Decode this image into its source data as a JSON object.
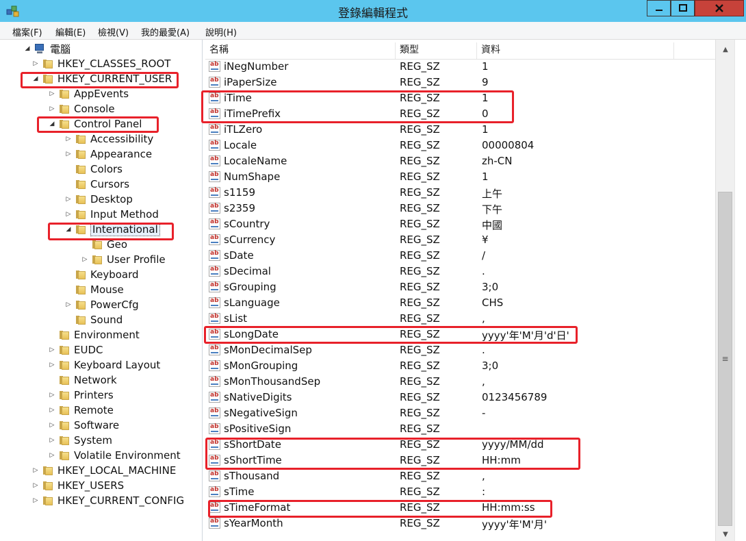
{
  "window": {
    "title": "登錄編輯程式"
  },
  "menu": [
    "檔案(F)",
    "編輯(E)",
    "檢視(V)",
    "我的最愛(A)",
    "說明(H)"
  ],
  "tree": [
    {
      "label": "電腦",
      "depth": 0,
      "exp": "open",
      "icon": "computer"
    },
    {
      "label": "HKEY_CLASSES_ROOT",
      "depth": 1,
      "exp": "closed"
    },
    {
      "label": "HKEY_CURRENT_USER",
      "depth": 1,
      "exp": "open"
    },
    {
      "label": "AppEvents",
      "depth": 2,
      "exp": "closed"
    },
    {
      "label": "Console",
      "depth": 2,
      "exp": "closed"
    },
    {
      "label": "Control Panel",
      "depth": 2,
      "exp": "open"
    },
    {
      "label": "Accessibility",
      "depth": 3,
      "exp": "closed"
    },
    {
      "label": "Appearance",
      "depth": 3,
      "exp": "closed"
    },
    {
      "label": "Colors",
      "depth": 3,
      "exp": "none"
    },
    {
      "label": "Cursors",
      "depth": 3,
      "exp": "none"
    },
    {
      "label": "Desktop",
      "depth": 3,
      "exp": "closed"
    },
    {
      "label": "Input Method",
      "depth": 3,
      "exp": "closed"
    },
    {
      "label": "International",
      "depth": 3,
      "exp": "open",
      "selected": true
    },
    {
      "label": "Geo",
      "depth": 4,
      "exp": "none"
    },
    {
      "label": "User Profile",
      "depth": 4,
      "exp": "closed"
    },
    {
      "label": "Keyboard",
      "depth": 3,
      "exp": "none"
    },
    {
      "label": "Mouse",
      "depth": 3,
      "exp": "none"
    },
    {
      "label": "PowerCfg",
      "depth": 3,
      "exp": "closed"
    },
    {
      "label": "Sound",
      "depth": 3,
      "exp": "none"
    },
    {
      "label": "Environment",
      "depth": 2,
      "exp": "none"
    },
    {
      "label": "EUDC",
      "depth": 2,
      "exp": "closed"
    },
    {
      "label": "Keyboard Layout",
      "depth": 2,
      "exp": "closed"
    },
    {
      "label": "Network",
      "depth": 2,
      "exp": "none"
    },
    {
      "label": "Printers",
      "depth": 2,
      "exp": "closed"
    },
    {
      "label": "Remote",
      "depth": 2,
      "exp": "closed"
    },
    {
      "label": "Software",
      "depth": 2,
      "exp": "closed"
    },
    {
      "label": "System",
      "depth": 2,
      "exp": "closed"
    },
    {
      "label": "Volatile Environment",
      "depth": 2,
      "exp": "closed"
    },
    {
      "label": "HKEY_LOCAL_MACHINE",
      "depth": 1,
      "exp": "closed"
    },
    {
      "label": "HKEY_USERS",
      "depth": 1,
      "exp": "closed"
    },
    {
      "label": "HKEY_CURRENT_CONFIG",
      "depth": 1,
      "exp": "closed"
    }
  ],
  "columns": {
    "name": "名稱",
    "type": "類型",
    "data": "資料"
  },
  "rows": [
    {
      "name": "iNegNumber",
      "type": "REG_SZ",
      "data": "1"
    },
    {
      "name": "iPaperSize",
      "type": "REG_SZ",
      "data": "9"
    },
    {
      "name": "iTime",
      "type": "REG_SZ",
      "data": "1"
    },
    {
      "name": "iTimePrefix",
      "type": "REG_SZ",
      "data": "0"
    },
    {
      "name": "iTLZero",
      "type": "REG_SZ",
      "data": "1"
    },
    {
      "name": "Locale",
      "type": "REG_SZ",
      "data": "00000804"
    },
    {
      "name": "LocaleName",
      "type": "REG_SZ",
      "data": "zh-CN"
    },
    {
      "name": "NumShape",
      "type": "REG_SZ",
      "data": "1"
    },
    {
      "name": "s1159",
      "type": "REG_SZ",
      "data": "上午"
    },
    {
      "name": "s2359",
      "type": "REG_SZ",
      "data": "下午"
    },
    {
      "name": "sCountry",
      "type": "REG_SZ",
      "data": "中國"
    },
    {
      "name": "sCurrency",
      "type": "REG_SZ",
      "data": "¥"
    },
    {
      "name": "sDate",
      "type": "REG_SZ",
      "data": "/"
    },
    {
      "name": "sDecimal",
      "type": "REG_SZ",
      "data": "."
    },
    {
      "name": "sGrouping",
      "type": "REG_SZ",
      "data": "3;0"
    },
    {
      "name": "sLanguage",
      "type": "REG_SZ",
      "data": "CHS"
    },
    {
      "name": "sList",
      "type": "REG_SZ",
      "data": ","
    },
    {
      "name": "sLongDate",
      "type": "REG_SZ",
      "data": "yyyy'年'M'月'd'日'"
    },
    {
      "name": "sMonDecimalSep",
      "type": "REG_SZ",
      "data": "."
    },
    {
      "name": "sMonGrouping",
      "type": "REG_SZ",
      "data": "3;0"
    },
    {
      "name": "sMonThousandSep",
      "type": "REG_SZ",
      "data": ","
    },
    {
      "name": "sNativeDigits",
      "type": "REG_SZ",
      "data": "0123456789"
    },
    {
      "name": "sNegativeSign",
      "type": "REG_SZ",
      "data": "-"
    },
    {
      "name": "sPositiveSign",
      "type": "REG_SZ",
      "data": ""
    },
    {
      "name": "sShortDate",
      "type": "REG_SZ",
      "data": "yyyy/MM/dd"
    },
    {
      "name": "sShortTime",
      "type": "REG_SZ",
      "data": "HH:mm"
    },
    {
      "name": "sThousand",
      "type": "REG_SZ",
      "data": ","
    },
    {
      "name": "sTime",
      "type": "REG_SZ",
      "data": ":"
    },
    {
      "name": "sTimeFormat",
      "type": "REG_SZ",
      "data": "HH:mm:ss"
    },
    {
      "name": "sYearMonth",
      "type": "REG_SZ",
      "data": "yyyy'年'M'月'"
    }
  ],
  "icons": {
    "app": "registry-editor-icon",
    "value": "string-value-icon",
    "folder": "folder-icon",
    "computer": "computer-icon"
  },
  "colors": {
    "titlebar": "#5bc6ee",
    "close": "#c7423a",
    "highlight": "#e8212a"
  }
}
